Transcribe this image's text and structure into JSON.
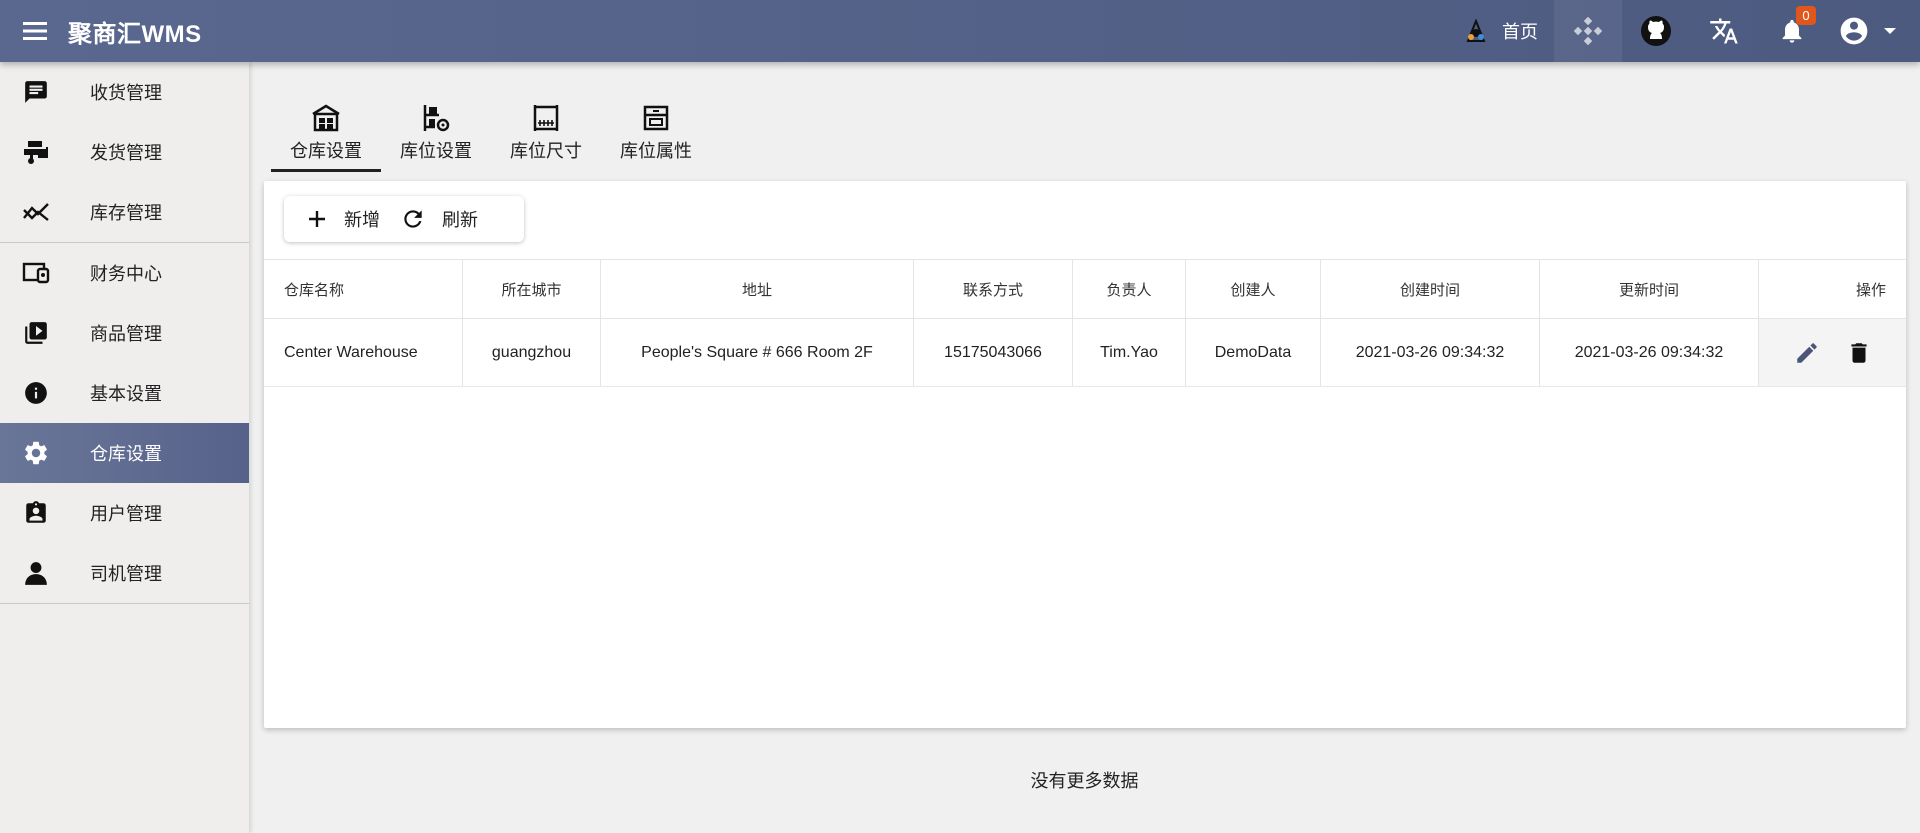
{
  "header": {
    "title": "聚商汇WMS",
    "home_label": "首页",
    "notification_count": "0",
    "icons": [
      "menu-icon",
      "home-icon",
      "diamond-icon",
      "github-icon",
      "translate-icon",
      "bell-icon",
      "account-icon",
      "caret-down-icon"
    ],
    "bg_color": "#55628a",
    "badge_color": "#e0571e"
  },
  "sidebar": {
    "items": [
      {
        "label": "收货管理",
        "icon": "inbox-message-icon"
      },
      {
        "label": "发货管理",
        "icon": "forklift-icon"
      },
      {
        "label": "库存管理",
        "icon": "trend-icon"
      },
      {
        "label": "财务中心",
        "icon": "devices-icon"
      },
      {
        "label": "商品管理",
        "icon": "video-library-icon"
      },
      {
        "label": "基本设置",
        "icon": "info-icon"
      },
      {
        "label": "仓库设置",
        "icon": "gear-icon"
      },
      {
        "label": "用户管理",
        "icon": "badge-icon"
      },
      {
        "label": "司机管理",
        "icon": "person-icon"
      }
    ],
    "active_index": 6,
    "active_color": "#5f6b90"
  },
  "tabs": [
    {
      "label": "仓库设置",
      "icon": "warehouse-icon"
    },
    {
      "label": "库位设置",
      "icon": "shelf-gear-icon"
    },
    {
      "label": "库位尺寸",
      "icon": "ruler-frame-icon"
    },
    {
      "label": "库位属性",
      "icon": "cabinet-icon"
    }
  ],
  "toolbar": {
    "add_label": "新增",
    "refresh_label": "刷新"
  },
  "table": {
    "columns": [
      "仓库名称",
      "所在城市",
      "地址",
      "联系方式",
      "负责人",
      "创建人",
      "创建时间",
      "更新时间",
      "操作"
    ],
    "rows": [
      [
        "Center Warehouse",
        "guangzhou",
        "People's Square # 666 Room 2F",
        "15175043066",
        "Tim.Yao",
        "DemoData",
        "2021-03-26 09:34:32",
        "2021-03-26 09:34:32"
      ]
    ],
    "row_actions": [
      "edit-icon",
      "delete-icon"
    ]
  },
  "footer_note": "没有更多数据"
}
